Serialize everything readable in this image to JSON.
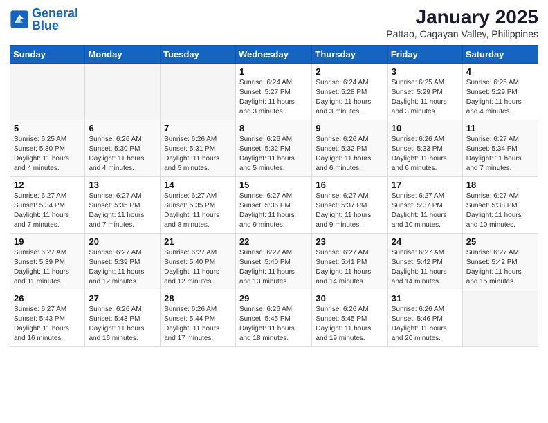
{
  "logo": {
    "text_general": "General",
    "text_blue": "Blue"
  },
  "header": {
    "title": "January 2025",
    "subtitle": "Pattao, Cagayan Valley, Philippines"
  },
  "columns": [
    "Sunday",
    "Monday",
    "Tuesday",
    "Wednesday",
    "Thursday",
    "Friday",
    "Saturday"
  ],
  "weeks": [
    [
      {
        "day": "",
        "info": ""
      },
      {
        "day": "",
        "info": ""
      },
      {
        "day": "",
        "info": ""
      },
      {
        "day": "1",
        "info": "Sunrise: 6:24 AM\nSunset: 5:27 PM\nDaylight: 11 hours\nand 3 minutes."
      },
      {
        "day": "2",
        "info": "Sunrise: 6:24 AM\nSunset: 5:28 PM\nDaylight: 11 hours\nand 3 minutes."
      },
      {
        "day": "3",
        "info": "Sunrise: 6:25 AM\nSunset: 5:29 PM\nDaylight: 11 hours\nand 3 minutes."
      },
      {
        "day": "4",
        "info": "Sunrise: 6:25 AM\nSunset: 5:29 PM\nDaylight: 11 hours\nand 4 minutes."
      }
    ],
    [
      {
        "day": "5",
        "info": "Sunrise: 6:25 AM\nSunset: 5:30 PM\nDaylight: 11 hours\nand 4 minutes."
      },
      {
        "day": "6",
        "info": "Sunrise: 6:26 AM\nSunset: 5:30 PM\nDaylight: 11 hours\nand 4 minutes."
      },
      {
        "day": "7",
        "info": "Sunrise: 6:26 AM\nSunset: 5:31 PM\nDaylight: 11 hours\nand 5 minutes."
      },
      {
        "day": "8",
        "info": "Sunrise: 6:26 AM\nSunset: 5:32 PM\nDaylight: 11 hours\nand 5 minutes."
      },
      {
        "day": "9",
        "info": "Sunrise: 6:26 AM\nSunset: 5:32 PM\nDaylight: 11 hours\nand 6 minutes."
      },
      {
        "day": "10",
        "info": "Sunrise: 6:26 AM\nSunset: 5:33 PM\nDaylight: 11 hours\nand 6 minutes."
      },
      {
        "day": "11",
        "info": "Sunrise: 6:27 AM\nSunset: 5:34 PM\nDaylight: 11 hours\nand 7 minutes."
      }
    ],
    [
      {
        "day": "12",
        "info": "Sunrise: 6:27 AM\nSunset: 5:34 PM\nDaylight: 11 hours\nand 7 minutes."
      },
      {
        "day": "13",
        "info": "Sunrise: 6:27 AM\nSunset: 5:35 PM\nDaylight: 11 hours\nand 7 minutes."
      },
      {
        "day": "14",
        "info": "Sunrise: 6:27 AM\nSunset: 5:35 PM\nDaylight: 11 hours\nand 8 minutes."
      },
      {
        "day": "15",
        "info": "Sunrise: 6:27 AM\nSunset: 5:36 PM\nDaylight: 11 hours\nand 9 minutes."
      },
      {
        "day": "16",
        "info": "Sunrise: 6:27 AM\nSunset: 5:37 PM\nDaylight: 11 hours\nand 9 minutes."
      },
      {
        "day": "17",
        "info": "Sunrise: 6:27 AM\nSunset: 5:37 PM\nDaylight: 11 hours\nand 10 minutes."
      },
      {
        "day": "18",
        "info": "Sunrise: 6:27 AM\nSunset: 5:38 PM\nDaylight: 11 hours\nand 10 minutes."
      }
    ],
    [
      {
        "day": "19",
        "info": "Sunrise: 6:27 AM\nSunset: 5:39 PM\nDaylight: 11 hours\nand 11 minutes."
      },
      {
        "day": "20",
        "info": "Sunrise: 6:27 AM\nSunset: 5:39 PM\nDaylight: 11 hours\nand 12 minutes."
      },
      {
        "day": "21",
        "info": "Sunrise: 6:27 AM\nSunset: 5:40 PM\nDaylight: 11 hours\nand 12 minutes."
      },
      {
        "day": "22",
        "info": "Sunrise: 6:27 AM\nSunset: 5:40 PM\nDaylight: 11 hours\nand 13 minutes."
      },
      {
        "day": "23",
        "info": "Sunrise: 6:27 AM\nSunset: 5:41 PM\nDaylight: 11 hours\nand 14 minutes."
      },
      {
        "day": "24",
        "info": "Sunrise: 6:27 AM\nSunset: 5:42 PM\nDaylight: 11 hours\nand 14 minutes."
      },
      {
        "day": "25",
        "info": "Sunrise: 6:27 AM\nSunset: 5:42 PM\nDaylight: 11 hours\nand 15 minutes."
      }
    ],
    [
      {
        "day": "26",
        "info": "Sunrise: 6:27 AM\nSunset: 5:43 PM\nDaylight: 11 hours\nand 16 minutes."
      },
      {
        "day": "27",
        "info": "Sunrise: 6:26 AM\nSunset: 5:43 PM\nDaylight: 11 hours\nand 16 minutes."
      },
      {
        "day": "28",
        "info": "Sunrise: 6:26 AM\nSunset: 5:44 PM\nDaylight: 11 hours\nand 17 minutes."
      },
      {
        "day": "29",
        "info": "Sunrise: 6:26 AM\nSunset: 5:45 PM\nDaylight: 11 hours\nand 18 minutes."
      },
      {
        "day": "30",
        "info": "Sunrise: 6:26 AM\nSunset: 5:45 PM\nDaylight: 11 hours\nand 19 minutes."
      },
      {
        "day": "31",
        "info": "Sunrise: 6:26 AM\nSunset: 5:46 PM\nDaylight: 11 hours\nand 20 minutes."
      },
      {
        "day": "",
        "info": ""
      }
    ]
  ]
}
